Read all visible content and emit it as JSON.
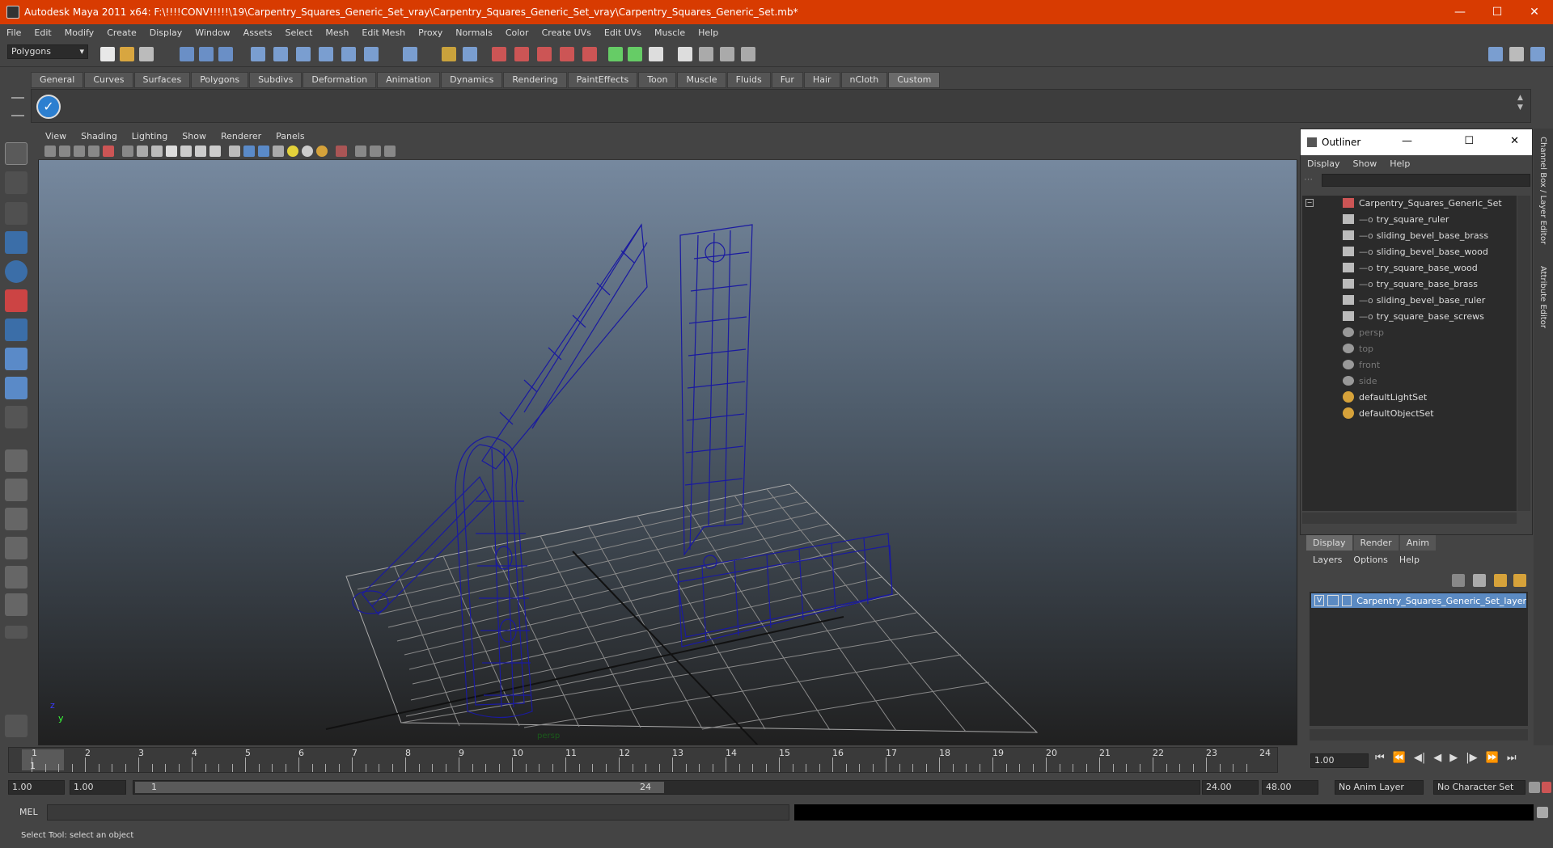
{
  "window": {
    "title": "Autodesk Maya 2011 x64: F:\\!!!!CONV!!!!!\\19\\Carpentry_Squares_Generic_Set_vray\\Carpentry_Squares_Generic_Set_vray\\Carpentry_Squares_Generic_Set.mb*",
    "minimize": "—",
    "maximize": "☐",
    "close": "✕"
  },
  "menubar": [
    "File",
    "Edit",
    "Modify",
    "Create",
    "Display",
    "Window",
    "Assets",
    "Select",
    "Mesh",
    "Edit Mesh",
    "Proxy",
    "Normals",
    "Color",
    "Create UVs",
    "Edit UVs",
    "Muscle",
    "Help"
  ],
  "statusline": {
    "mode": "Polygons"
  },
  "shelf": {
    "tabs": [
      "General",
      "Curves",
      "Surfaces",
      "Polygons",
      "Subdivs",
      "Deformation",
      "Animation",
      "Dynamics",
      "Rendering",
      "PaintEffects",
      "Toon",
      "Muscle",
      "Fluids",
      "Fur",
      "Hair",
      "nCloth",
      "Custom"
    ],
    "active_tab": "Custom"
  },
  "viewport": {
    "menu": [
      "View",
      "Shading",
      "Lighting",
      "Show",
      "Renderer",
      "Panels"
    ],
    "camera_label": "persp",
    "axis_y": "y",
    "axis_z": "z"
  },
  "outliner": {
    "title": "Outliner",
    "menu": [
      "Display",
      "Show",
      "Help"
    ],
    "items": [
      {
        "label": "Carpentry_Squares_Generic_Set",
        "dim": false
      },
      {
        "label": "try_square_ruler",
        "dim": false
      },
      {
        "label": "sliding_bevel_base_brass",
        "dim": false
      },
      {
        "label": "sliding_bevel_base_wood",
        "dim": false
      },
      {
        "label": "try_square_base_wood",
        "dim": false
      },
      {
        "label": "try_square_base_brass",
        "dim": false
      },
      {
        "label": "sliding_bevel_base_ruler",
        "dim": false
      },
      {
        "label": "try_square_base_screws",
        "dim": false
      },
      {
        "label": "persp",
        "dim": true
      },
      {
        "label": "top",
        "dim": true
      },
      {
        "label": "front",
        "dim": true
      },
      {
        "label": "side",
        "dim": true
      },
      {
        "label": "defaultLightSet",
        "dim": false
      },
      {
        "label": "defaultObjectSet",
        "dim": false
      }
    ]
  },
  "layers": {
    "tabs": [
      "Display",
      "Render",
      "Anim"
    ],
    "active_tab": "Display",
    "menu": [
      "Layers",
      "Options",
      "Help"
    ],
    "layer_visibility": "V",
    "layer_name": "Carpentry_Squares_Generic_Set_layer"
  },
  "rightstrip": {
    "channel_box": "Channel Box / Layer Editor",
    "attribute_editor": "Attribute Editor"
  },
  "timeline": {
    "ticks": [
      "1",
      "2",
      "3",
      "4",
      "5",
      "6",
      "7",
      "8",
      "9",
      "10",
      "11",
      "12",
      "13",
      "14",
      "15",
      "16",
      "17",
      "18",
      "19",
      "20",
      "21",
      "22",
      "23",
      "24"
    ],
    "current_marker": "1",
    "current_frame": "1.00"
  },
  "range": {
    "start": "1.00",
    "playback_start": "1.00",
    "slider_start": "1",
    "slider_end": "24",
    "playback_end": "24.00",
    "end": "48.00",
    "anim_layer": "No Anim Layer",
    "character_set": "No Character Set"
  },
  "command": {
    "label": "MEL"
  },
  "help": {
    "text": "Select Tool: select an object"
  }
}
